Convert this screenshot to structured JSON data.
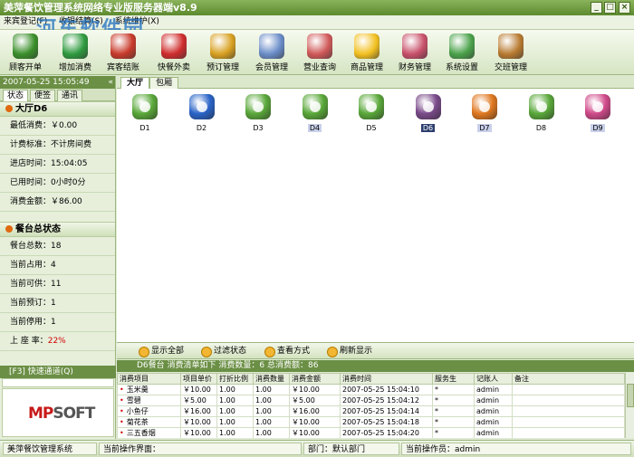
{
  "window": {
    "title": "美萍餐饮管理系统网络专业版服务器端v8.9",
    "min": "_",
    "max": "□",
    "close": "×"
  },
  "menu": [
    "来宾登记(F)",
    "收银结算(S)",
    "系统维护(X)"
  ],
  "watermark": {
    "text": "河东软件园",
    "url": "www.pc0359.cn"
  },
  "toolbar": [
    {
      "label": "顾客开单",
      "icon": "open-order-icon",
      "color": "#3a8f2a"
    },
    {
      "label": "增加消费",
      "icon": "add-consumption-icon",
      "color": "#2e9a3e"
    },
    {
      "label": "宾客结账",
      "icon": "checkout-icon",
      "color": "#c83a2a"
    },
    {
      "label": "快餐外卖",
      "icon": "takeout-icon",
      "color": "#cf2c2c"
    },
    {
      "label": "预订管理",
      "icon": "clock-icon",
      "color": "#d8a020"
    },
    {
      "label": "会员管理",
      "icon": "members-icon",
      "color": "#6a8cc8"
    },
    {
      "label": "营业查询",
      "icon": "search-book-icon",
      "color": "#d05858"
    },
    {
      "label": "商品管理",
      "icon": "star-icon",
      "color": "#f2c020"
    },
    {
      "label": "财务管理",
      "icon": "calculator-icon",
      "color": "#c8506a"
    },
    {
      "label": "系统设置",
      "icon": "gear-icon",
      "color": "#4aa24a"
    },
    {
      "label": "交班管理",
      "icon": "exit-door-icon",
      "color": "#b87a30"
    }
  ],
  "left": {
    "datetime": "2007-05-25 15:05:49",
    "collapse": "«",
    "tabs": [
      "状态",
      "便签",
      "通讯"
    ],
    "current_table": {
      "title": "大厅D6",
      "rows": [
        {
          "label": "最低消费：",
          "value": "￥0.00"
        },
        {
          "label": "计费标准：",
          "value": "不计房间费"
        },
        {
          "label": "进店时间：",
          "value": "15:04:05"
        },
        {
          "label": "已用时间：",
          "value": "0小时0分"
        },
        {
          "label": "消费金额：",
          "value": "￥86.00"
        }
      ]
    },
    "summary": {
      "title": "餐台总状态",
      "rows": [
        {
          "label": "餐台总数：",
          "value": "18"
        },
        {
          "label": "当前占用：",
          "value": "4"
        },
        {
          "label": "当前可供：",
          "value": "11"
        },
        {
          "label": "当前预订：",
          "value": "1"
        },
        {
          "label": "当前停用：",
          "value": "1"
        },
        {
          "label": "上 座 率：",
          "value": "22%"
        }
      ]
    },
    "quick_nav": "[F3] 快速通道(Q)",
    "logo": {
      "a": "MP",
      "b": "SOFT"
    }
  },
  "main": {
    "tabs": [
      "大厅",
      "包厢"
    ],
    "tables": [
      {
        "name": "D1",
        "color": "#5aa83a",
        "state": "free"
      },
      {
        "name": "D2",
        "color": "#2a64c8",
        "state": "busy"
      },
      {
        "name": "D3",
        "color": "#5aa83a",
        "state": "free"
      },
      {
        "name": "D4",
        "color": "#5aa83a",
        "state": "busy"
      },
      {
        "name": "D5",
        "color": "#5aa83a",
        "state": "free"
      },
      {
        "name": "D6",
        "color": "#7a4a8a",
        "state": "selected"
      },
      {
        "name": "D7",
        "color": "#e07820",
        "state": "reserved"
      },
      {
        "name": "D8",
        "color": "#5aa83a",
        "state": "free"
      },
      {
        "name": "D9",
        "color": "#d04a8a",
        "state": "disabled"
      }
    ]
  },
  "midbar": [
    "显示全部",
    "过滤状态",
    "查看方式",
    "刷新显示"
  ],
  "infobar": "D6餐台   消费清单如下 消费数量：6 总消费额：86",
  "grid": {
    "columns": [
      "消费项目",
      "项目单价",
      "打折比例",
      "消费数量",
      "消费金额",
      "消费时间",
      "服务生",
      "记账人",
      "备注"
    ],
    "rows": [
      [
        "玉米羹",
        "￥10.00",
        "1.00",
        "1.00",
        "￥10.00",
        "2007-05-25 15:04:10",
        "*",
        "admin",
        ""
      ],
      [
        "雪碧",
        "￥5.00",
        "1.00",
        "1.00",
        "￥5.00",
        "2007-05-25 15:04:12",
        "*",
        "admin",
        ""
      ],
      [
        "小鱼仔",
        "￥16.00",
        "1.00",
        "1.00",
        "￥16.00",
        "2007-05-25 15:04:14",
        "*",
        "admin",
        ""
      ],
      [
        "菊花茶",
        "￥10.00",
        "1.00",
        "1.00",
        "￥10.00",
        "2007-05-25 15:04:18",
        "*",
        "admin",
        ""
      ],
      [
        "三五香烟",
        "￥10.00",
        "1.00",
        "1.00",
        "￥10.00",
        "2007-05-25 15:04:20",
        "*",
        "admin",
        ""
      ]
    ]
  },
  "status": {
    "app": "美萍餐饮管理系统",
    "screen": "当前操作界面：",
    "dept": "部门：默认部门",
    "operator": "当前操作员：admin"
  }
}
